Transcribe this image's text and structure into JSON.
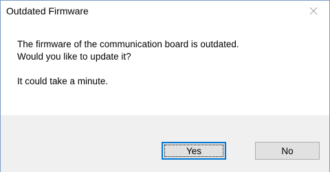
{
  "window": {
    "title": "Outdated Firmware",
    "close_icon": "close-icon"
  },
  "message": {
    "line1": "The firmware of the communication board is outdated.",
    "line2": "Would you like to update it?",
    "line3": "It could take a minute."
  },
  "buttons": {
    "yes_label": "Yes",
    "no_label": "No"
  },
  "colors": {
    "window_border": "#7a9cc6",
    "footer_background": "#f0f0f0",
    "button_background": "#e1e1e1",
    "default_button_border": "#0078d7"
  }
}
